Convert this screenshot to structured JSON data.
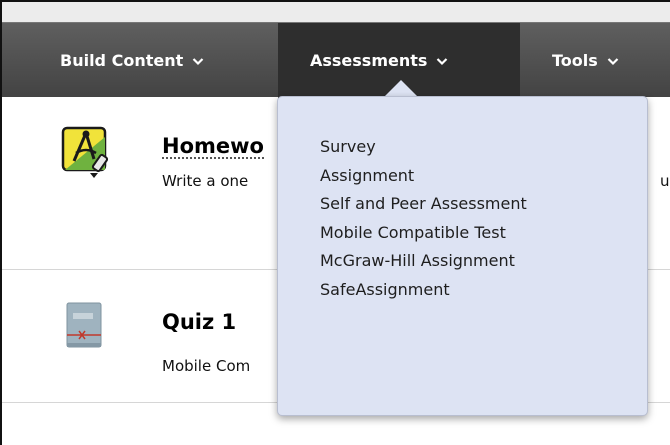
{
  "toolbar": {
    "build_content": "Build Content",
    "assessments": "Assessments",
    "tools": "Tools"
  },
  "items": [
    {
      "title": "Homewo",
      "description": "Write a one",
      "clipped_right_text": "ur",
      "icon": "assignment-icon"
    },
    {
      "title": "Quiz 1",
      "description": "Mobile Com",
      "icon": "test-icon"
    }
  ],
  "dropdown": {
    "items": [
      "Survey",
      "Assignment",
      "Self and Peer Assessment",
      "Mobile Compatible Test",
      "McGraw-Hill Assignment",
      "SafeAssignment"
    ]
  },
  "colors": {
    "toolbar": "#4f4f4f",
    "toolbar_active": "#2e2e2e",
    "dropdown_bg": "#dde3f3"
  }
}
